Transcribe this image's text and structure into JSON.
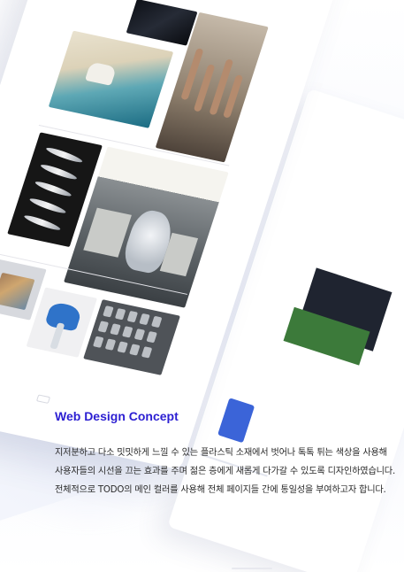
{
  "section": {
    "title": "Web Design Concept",
    "description_lines": [
      "지저분하고 다소 밋밋하게 느낄 수 있는 플라스틱 소재에서 벗어나 톡톡 튀는 색상을 사용해",
      "사용자들의 시선을 끄는 효과를 주며 젊은 층에게 새롭게 다가갈 수 있도록 디자인하였습니다.",
      "전체적으로 TODO의 메인 컬러를 사용해 전체 페이지들 간에 통일성을 부여하고자 합니다."
    ]
  },
  "colors": {
    "accent": "#2c1fd2",
    "body_text": "#2a2a2a",
    "background": "#ffffff"
  }
}
